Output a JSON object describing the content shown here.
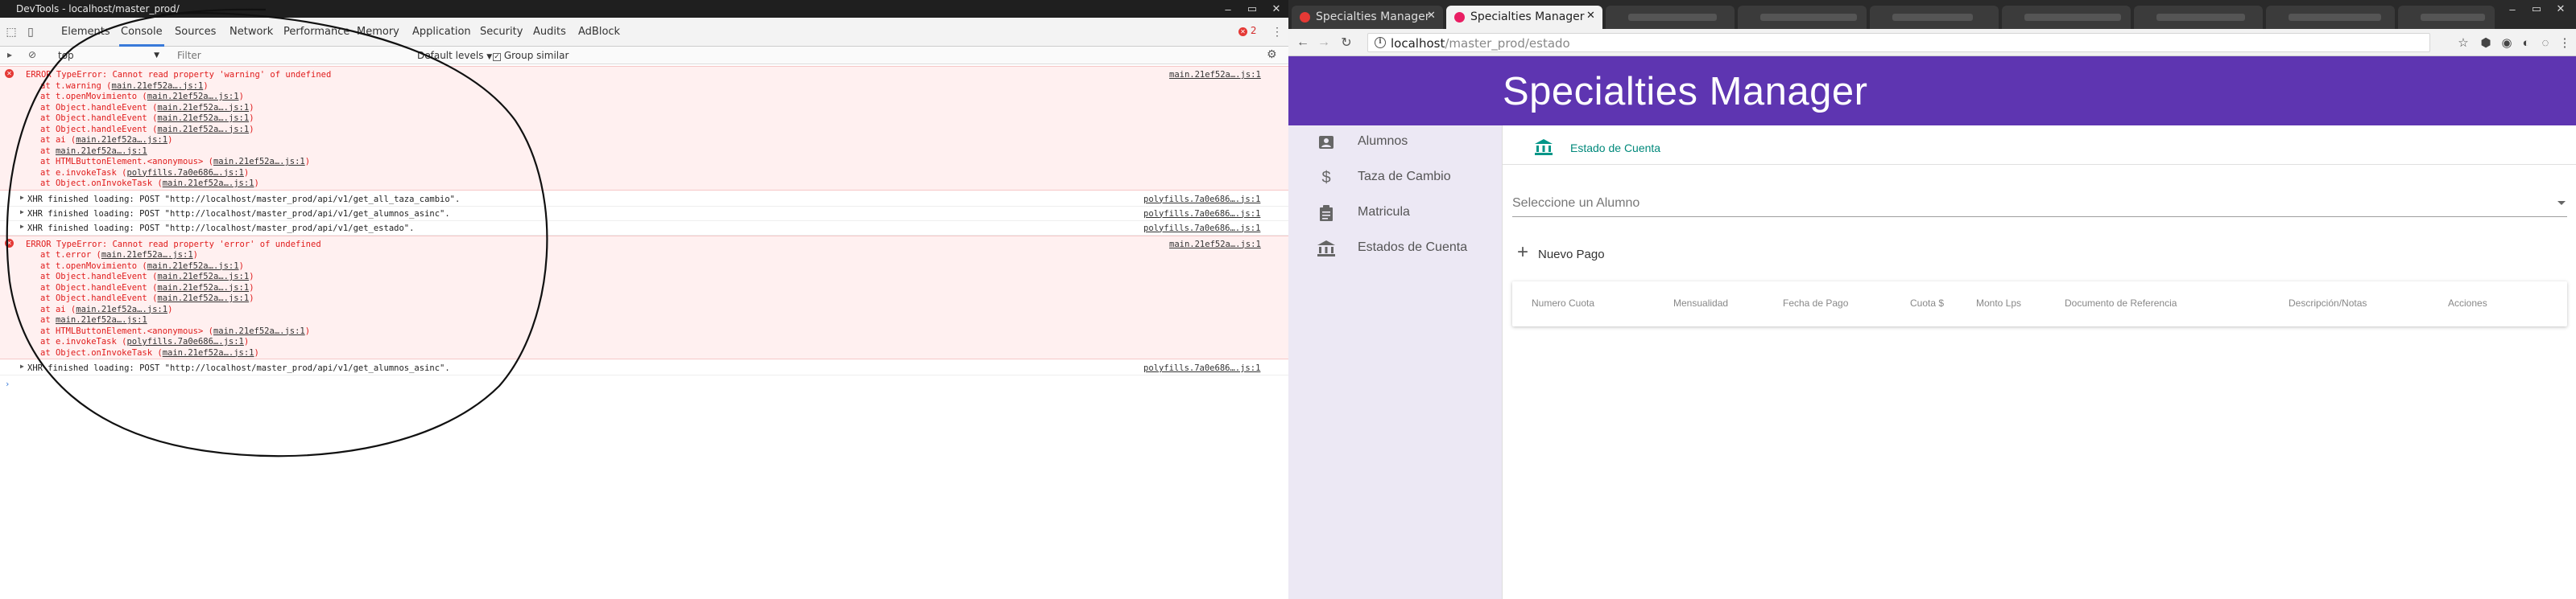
{
  "devtools": {
    "window_title": "DevTools - localhost/master_prod/",
    "tabs": [
      "Elements",
      "Console",
      "Sources",
      "Network",
      "Performance",
      "Memory",
      "Application",
      "Security",
      "Audits",
      "AdBlock"
    ],
    "active_tab": "Console",
    "error_count": "2",
    "console_bar": {
      "context": "top",
      "filter_placeholder": "Filter",
      "levels": "Default levels",
      "group_similar": "Group similar"
    },
    "messages": [
      {
        "type": "error",
        "text": "ERROR TypeError: Cannot read property 'warning' of undefined",
        "source": "main.21ef52a….js:1",
        "stack": [
          {
            "prefix": "at t.warning (",
            "link": "main.21ef52a….js:1",
            "suffix": ")"
          },
          {
            "prefix": "at t.openMovimiento (",
            "link": "main.21ef52a….js:1",
            "suffix": ")"
          },
          {
            "prefix": "at Object.handleEvent (",
            "link": "main.21ef52a….js:1",
            "suffix": ")"
          },
          {
            "prefix": "at Object.handleEvent (",
            "link": "main.21ef52a….js:1",
            "suffix": ")"
          },
          {
            "prefix": "at Object.handleEvent (",
            "link": "main.21ef52a….js:1",
            "suffix": ")"
          },
          {
            "prefix": "at ai (",
            "link": "main.21ef52a….js:1",
            "suffix": ")"
          },
          {
            "prefix": "at ",
            "link": "main.21ef52a….js:1",
            "suffix": ""
          },
          {
            "prefix": "at HTMLButtonElement.<anonymous> (",
            "link": "main.21ef52a….js:1",
            "suffix": ")"
          },
          {
            "prefix": "at e.invokeTask (",
            "link": "polyfills.7a0e686….js:1",
            "suffix": ")"
          },
          {
            "prefix": "at Object.onInvokeTask (",
            "link": "main.21ef52a….js:1",
            "suffix": ")"
          }
        ]
      },
      {
        "type": "xhr",
        "text": "XHR finished loading: POST \"http://localhost/master_prod/api/v1/get_all_taza_cambio\".",
        "source": "polyfills.7a0e686….js:1"
      },
      {
        "type": "xhr",
        "text": "XHR finished loading: POST \"http://localhost/master_prod/api/v1/get_alumnos_asinc\".",
        "source": "polyfills.7a0e686….js:1"
      },
      {
        "type": "xhr",
        "text": "XHR finished loading: POST \"http://localhost/master_prod/api/v1/get_estado\".",
        "source": "polyfills.7a0e686….js:1"
      },
      {
        "type": "error",
        "text": "ERROR TypeError: Cannot read property 'error' of undefined",
        "source": "main.21ef52a….js:1",
        "stack": [
          {
            "prefix": "at t.error (",
            "link": "main.21ef52a….js:1",
            "suffix": ")"
          },
          {
            "prefix": "at t.openMovimiento (",
            "link": "main.21ef52a….js:1",
            "suffix": ")"
          },
          {
            "prefix": "at Object.handleEvent (",
            "link": "main.21ef52a….js:1",
            "suffix": ")"
          },
          {
            "prefix": "at Object.handleEvent (",
            "link": "main.21ef52a….js:1",
            "suffix": ")"
          },
          {
            "prefix": "at Object.handleEvent (",
            "link": "main.21ef52a….js:1",
            "suffix": ")"
          },
          {
            "prefix": "at ai (",
            "link": "main.21ef52a….js:1",
            "suffix": ")"
          },
          {
            "prefix": "at ",
            "link": "main.21ef52a….js:1",
            "suffix": ""
          },
          {
            "prefix": "at HTMLButtonElement.<anonymous> (",
            "link": "main.21ef52a….js:1",
            "suffix": ")"
          },
          {
            "prefix": "at e.invokeTask (",
            "link": "polyfills.7a0e686….js:1",
            "suffix": ")"
          },
          {
            "prefix": "at Object.onInvokeTask (",
            "link": "main.21ef52a….js:1",
            "suffix": ")"
          }
        ]
      },
      {
        "type": "xhr",
        "text": "XHR finished loading: POST \"http://localhost/master_prod/api/v1/get_alumnos_asinc\".",
        "source": "polyfills.7a0e686….js:1"
      }
    ],
    "prompt": "›"
  },
  "browser": {
    "tabs": [
      {
        "label": "Specialties Manager",
        "active": false
      },
      {
        "label": "Specialties Manager",
        "active": true
      }
    ],
    "url_host": "localhost",
    "url_path": "/master_prod/estado"
  },
  "app": {
    "title": "Specialties Manager",
    "sidebar": [
      {
        "label": "Alumnos",
        "icon": "person-card-icon"
      },
      {
        "label": "Taza de Cambio",
        "icon": "dollar-icon"
      },
      {
        "label": "Matricula",
        "icon": "clipboard-icon"
      },
      {
        "label": "Estados de Cuenta",
        "icon": "bank-icon"
      }
    ],
    "breadcrumb": "Estado de Cuenta",
    "select_placeholder": "Seleccione un Alumno",
    "new_payment": "Nuevo Pago",
    "table_headers": [
      "Numero Cuota",
      "Mensualidad",
      "Fecha de Pago",
      "Cuota $",
      "Monto Lps",
      "Documento de Referencia",
      "Descripción/Notas",
      "Acciones"
    ]
  },
  "colors": {
    "header": "#5e35b1",
    "sidebar": "#ece8f4",
    "accent": "#009688",
    "error": "#e01b1b"
  }
}
